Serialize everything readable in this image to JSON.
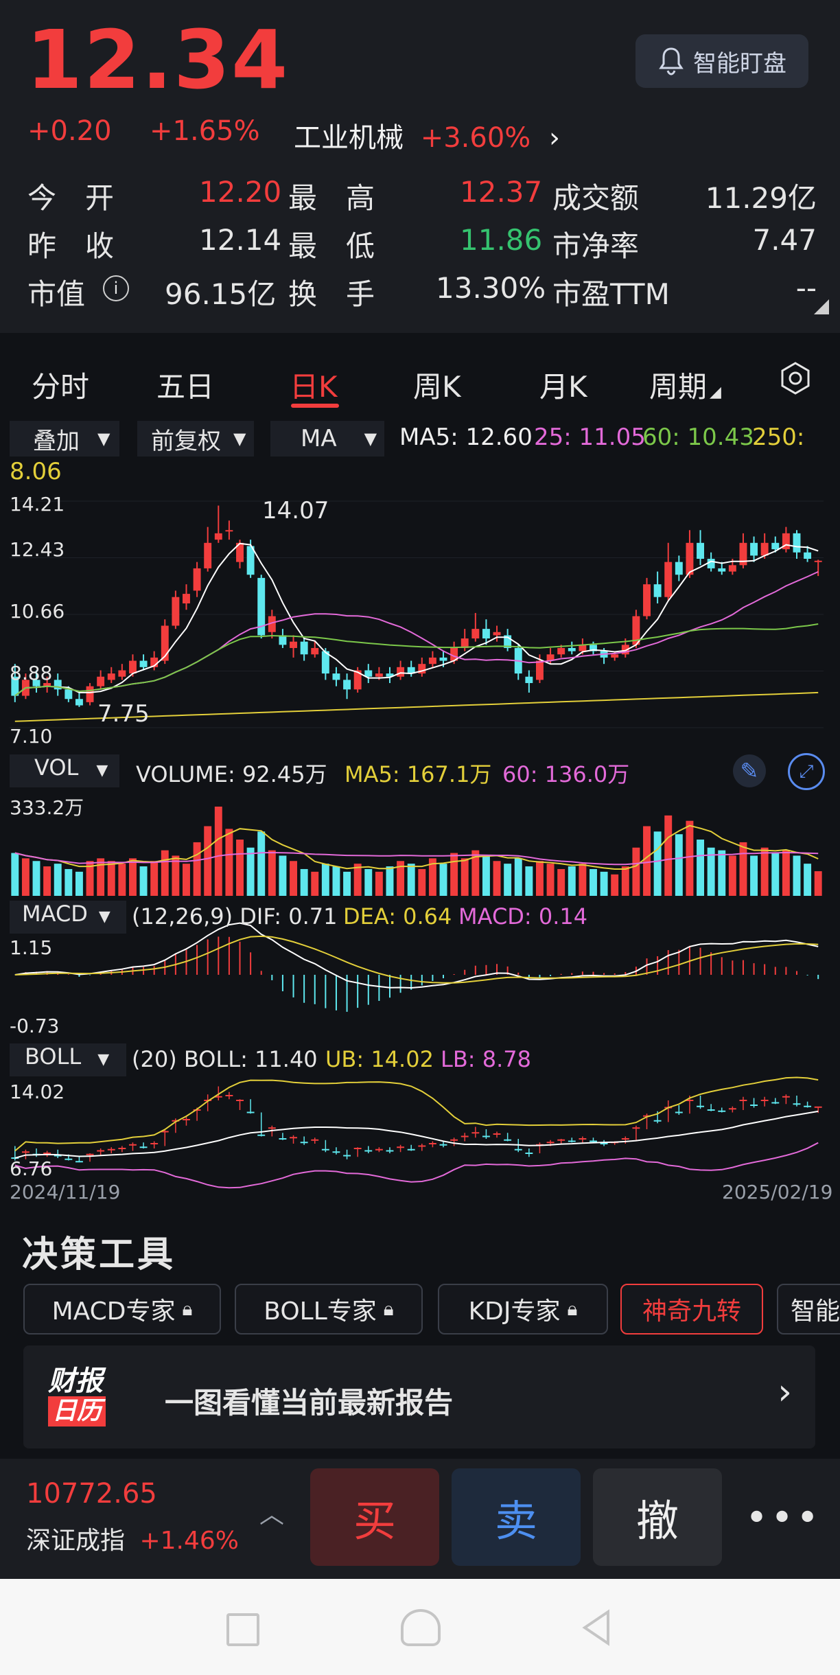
{
  "quote": {
    "price": "12.34",
    "change": "+0.20",
    "change_pct": "+1.65%",
    "sector": "工业机械",
    "sector_change": "+3.60%",
    "smart_watch_label": "智能盯盘"
  },
  "stats": [
    {
      "label": "今　开",
      "value": "12.20",
      "tone": "red"
    },
    {
      "label": "最　高",
      "value": "12.37",
      "tone": "red"
    },
    {
      "label": "成交额",
      "value": "11.29亿",
      "tone": "white"
    },
    {
      "label": "昨　收",
      "value": "12.14",
      "tone": "white"
    },
    {
      "label": "最　低",
      "value": "11.86",
      "tone": "green"
    },
    {
      "label": "市净率",
      "value": "7.47",
      "tone": "white"
    },
    {
      "label": "市值",
      "value": "96.15亿",
      "tone": "white"
    },
    {
      "label": "换　手",
      "value": "13.30%",
      "tone": "white"
    },
    {
      "label": "市盈TTM",
      "value": "--",
      "tone": "white"
    }
  ],
  "tabs": [
    "分时",
    "五日",
    "日K",
    "周K",
    "月K",
    "周期"
  ],
  "active_tab": "日K",
  "chart_controls": {
    "overlay": "叠加",
    "adjust": "前复权",
    "indicator": "MA",
    "ma5_label": "MA5: 12.60",
    "ma25_label": "25: 11.05",
    "ma60_label": "60: 10.43",
    "ma250_label": "250:",
    "ma250_value": "8.06"
  },
  "kline_axis": {
    "y_top": "14.21",
    "y_2": "12.43",
    "y_3": "10.66",
    "y_4": "8.88",
    "y_bottom": "7.10",
    "high_marker": "14.07",
    "low_marker": "7.75"
  },
  "volume_panel": {
    "selector": "VOL",
    "volume_label": "VOLUME: 92.45万",
    "ma5_label": "MA5: 167.1万",
    "ma60_label": "60: 136.0万",
    "max_label": "333.2万"
  },
  "macd_panel": {
    "selector": "MACD",
    "params": "(12,26,9) DIF: 0.71",
    "dea": "DEA: 0.64",
    "macd": "MACD: 0.14",
    "y_top": "1.15",
    "y_bottom": "-0.73"
  },
  "boll_panel": {
    "selector": "BOLL",
    "params": "(20) BOLL: 11.40",
    "ub": "UB: 14.02",
    "lb": "LB: 8.78",
    "y_top": "14.02",
    "y_bottom": "6.76",
    "date_start": "2024/11/19",
    "date_end": "2025/02/19"
  },
  "decision_tools": {
    "title": "决策工具",
    "items": [
      "MACD专家",
      "BOLL专家",
      "KDJ专家",
      "神奇九转",
      "智能"
    ]
  },
  "report_banner": {
    "logo_top": "财报",
    "logo_bottom": "日历",
    "text": "一图看懂当前最新报告"
  },
  "bottom_bar": {
    "index_value": "10772.65",
    "index_name": "深证成指",
    "index_change": "+1.46%",
    "buy": "买",
    "sell": "卖",
    "cancel": "撤"
  },
  "colors": {
    "up": "#f23d3d",
    "down": "#35c36f",
    "down_bar": "#5ee7ee",
    "ma5": "#ffffff",
    "ma25": "#e36ad9",
    "ma60": "#7cc84a",
    "ma250": "#e3cf3a",
    "background": "#101216"
  },
  "chart_data": {
    "type": "candlestick",
    "y_range": [
      7.1,
      14.21
    ],
    "candles": [
      {
        "o": 8.7,
        "c": 8.1,
        "h": 9.1,
        "l": 7.9
      },
      {
        "o": 8.1,
        "c": 8.6,
        "h": 8.8,
        "l": 8.0
      },
      {
        "o": 8.6,
        "c": 8.4,
        "h": 8.9,
        "l": 8.2
      },
      {
        "o": 8.4,
        "c": 8.5,
        "h": 8.7,
        "l": 8.2
      },
      {
        "o": 8.6,
        "c": 8.3,
        "h": 8.8,
        "l": 8.1
      },
      {
        "o": 8.3,
        "c": 8.0,
        "h": 8.4,
        "l": 7.9
      },
      {
        "o": 8.0,
        "c": 7.8,
        "h": 8.2,
        "l": 7.75
      },
      {
        "o": 7.9,
        "c": 8.4,
        "h": 8.5,
        "l": 7.8
      },
      {
        "o": 8.4,
        "c": 8.7,
        "h": 8.9,
        "l": 8.3
      },
      {
        "o": 8.6,
        "c": 8.8,
        "h": 9.0,
        "l": 8.5
      },
      {
        "o": 8.7,
        "c": 8.9,
        "h": 9.1,
        "l": 8.6
      },
      {
        "o": 8.8,
        "c": 9.2,
        "h": 9.4,
        "l": 8.7
      },
      {
        "o": 9.2,
        "c": 9.0,
        "h": 9.4,
        "l": 8.9
      },
      {
        "o": 9.0,
        "c": 9.3,
        "h": 9.5,
        "l": 8.9
      },
      {
        "o": 9.2,
        "c": 10.3,
        "h": 10.5,
        "l": 9.1
      },
      {
        "o": 10.3,
        "c": 11.2,
        "h": 11.4,
        "l": 10.2
      },
      {
        "o": 11.0,
        "c": 11.3,
        "h": 11.6,
        "l": 10.8
      },
      {
        "o": 11.4,
        "c": 12.1,
        "h": 12.3,
        "l": 11.2
      },
      {
        "o": 12.1,
        "c": 12.9,
        "h": 13.4,
        "l": 12.0
      },
      {
        "o": 13.0,
        "c": 13.2,
        "h": 14.07,
        "l": 12.9
      },
      {
        "o": 13.3,
        "c": 13.3,
        "h": 13.6,
        "l": 13.0
      },
      {
        "o": 12.3,
        "c": 12.9,
        "h": 13.0,
        "l": 12.1
      },
      {
        "o": 12.8,
        "c": 11.9,
        "h": 13.0,
        "l": 11.8
      },
      {
        "o": 11.8,
        "c": 10.0,
        "h": 11.9,
        "l": 9.9
      },
      {
        "o": 10.1,
        "c": 10.6,
        "h": 10.8,
        "l": 9.9
      },
      {
        "o": 10.0,
        "c": 9.7,
        "h": 10.2,
        "l": 9.6
      },
      {
        "o": 9.6,
        "c": 9.8,
        "h": 10.0,
        "l": 9.3
      },
      {
        "o": 9.8,
        "c": 9.4,
        "h": 9.9,
        "l": 9.2
      },
      {
        "o": 9.4,
        "c": 9.6,
        "h": 9.8,
        "l": 9.3
      },
      {
        "o": 9.5,
        "c": 8.8,
        "h": 9.6,
        "l": 8.6
      },
      {
        "o": 8.8,
        "c": 8.6,
        "h": 9.0,
        "l": 8.4
      },
      {
        "o": 8.6,
        "c": 8.3,
        "h": 8.8,
        "l": 8.0
      },
      {
        "o": 8.3,
        "c": 8.9,
        "h": 9.0,
        "l": 8.2
      },
      {
        "o": 8.9,
        "c": 8.7,
        "h": 9.1,
        "l": 8.5
      },
      {
        "o": 8.7,
        "c": 8.8,
        "h": 9.0,
        "l": 8.6
      },
      {
        "o": 8.8,
        "c": 8.7,
        "h": 9.0,
        "l": 8.5
      },
      {
        "o": 8.7,
        "c": 9.0,
        "h": 9.2,
        "l": 8.6
      },
      {
        "o": 9.0,
        "c": 8.8,
        "h": 9.2,
        "l": 8.7
      },
      {
        "o": 8.8,
        "c": 9.1,
        "h": 9.3,
        "l": 8.7
      },
      {
        "o": 9.1,
        "c": 9.3,
        "h": 9.5,
        "l": 9.0
      },
      {
        "o": 9.3,
        "c": 9.2,
        "h": 9.5,
        "l": 9.0
      },
      {
        "o": 9.2,
        "c": 9.6,
        "h": 9.8,
        "l": 9.1
      },
      {
        "o": 9.6,
        "c": 9.9,
        "h": 10.2,
        "l": 9.5
      },
      {
        "o": 9.9,
        "c": 10.2,
        "h": 10.7,
        "l": 9.8
      },
      {
        "o": 10.2,
        "c": 9.9,
        "h": 10.5,
        "l": 9.7
      },
      {
        "o": 10.0,
        "c": 10.1,
        "h": 10.3,
        "l": 9.8
      },
      {
        "o": 10.0,
        "c": 9.6,
        "h": 10.2,
        "l": 9.5
      },
      {
        "o": 9.6,
        "c": 8.8,
        "h": 9.7,
        "l": 8.6
      },
      {
        "o": 8.7,
        "c": 8.5,
        "h": 8.9,
        "l": 8.2
      },
      {
        "o": 8.6,
        "c": 9.2,
        "h": 9.4,
        "l": 8.5
      },
      {
        "o": 9.2,
        "c": 9.4,
        "h": 9.6,
        "l": 9.1
      },
      {
        "o": 9.4,
        "c": 9.6,
        "h": 9.7,
        "l": 9.3
      },
      {
        "o": 9.6,
        "c": 9.5,
        "h": 9.8,
        "l": 9.4
      },
      {
        "o": 9.5,
        "c": 9.7,
        "h": 9.9,
        "l": 9.4
      },
      {
        "o": 9.7,
        "c": 9.5,
        "h": 9.8,
        "l": 9.4
      },
      {
        "o": 9.5,
        "c": 9.3,
        "h": 9.6,
        "l": 9.1
      },
      {
        "o": 9.3,
        "c": 9.4,
        "h": 9.5,
        "l": 9.2
      },
      {
        "o": 9.4,
        "c": 9.7,
        "h": 9.9,
        "l": 9.3
      },
      {
        "o": 9.7,
        "c": 10.6,
        "h": 10.8,
        "l": 9.6
      },
      {
        "o": 10.6,
        "c": 11.6,
        "h": 11.8,
        "l": 10.5
      },
      {
        "o": 11.6,
        "c": 11.2,
        "h": 12.0,
        "l": 11.0
      },
      {
        "o": 11.2,
        "c": 12.3,
        "h": 12.9,
        "l": 11.1
      },
      {
        "o": 12.3,
        "c": 11.9,
        "h": 12.5,
        "l": 11.7
      },
      {
        "o": 11.9,
        "c": 12.9,
        "h": 13.3,
        "l": 11.8
      },
      {
        "o": 12.9,
        "c": 12.4,
        "h": 13.3,
        "l": 12.2
      },
      {
        "o": 12.4,
        "c": 12.1,
        "h": 12.6,
        "l": 12.0
      },
      {
        "o": 12.1,
        "c": 12.0,
        "h": 12.3,
        "l": 11.9
      },
      {
        "o": 12.0,
        "c": 12.2,
        "h": 12.4,
        "l": 11.9
      },
      {
        "o": 12.2,
        "c": 12.9,
        "h": 13.2,
        "l": 12.1
      },
      {
        "o": 12.9,
        "c": 12.5,
        "h": 13.1,
        "l": 12.3
      },
      {
        "o": 12.5,
        "c": 12.9,
        "h": 13.2,
        "l": 12.4
      },
      {
        "o": 12.9,
        "c": 12.7,
        "h": 13.1,
        "l": 12.6
      },
      {
        "o": 12.7,
        "c": 13.2,
        "h": 13.4,
        "l": 12.6
      },
      {
        "o": 13.2,
        "c": 12.6,
        "h": 13.3,
        "l": 12.4
      },
      {
        "o": 12.6,
        "c": 12.4,
        "h": 12.8,
        "l": 12.3
      },
      {
        "o": 12.3,
        "c": 12.34,
        "h": 12.37,
        "l": 11.86
      }
    ],
    "volumes": [
      160,
      140,
      130,
      110,
      120,
      100,
      90,
      130,
      140,
      130,
      120,
      140,
      110,
      130,
      170,
      150,
      120,
      200,
      260,
      333,
      250,
      210,
      180,
      240,
      170,
      150,
      130,
      100,
      90,
      120,
      110,
      90,
      120,
      100,
      90,
      110,
      130,
      120,
      100,
      140,
      120,
      160,
      140,
      170,
      150,
      130,
      120,
      140,
      110,
      130,
      120,
      100,
      110,
      120,
      100,
      90,
      80,
      110,
      180,
      260,
      240,
      300,
      230,
      280,
      210,
      180,
      170,
      150,
      200,
      150,
      180,
      160,
      170,
      150,
      120,
      92
    ]
  }
}
